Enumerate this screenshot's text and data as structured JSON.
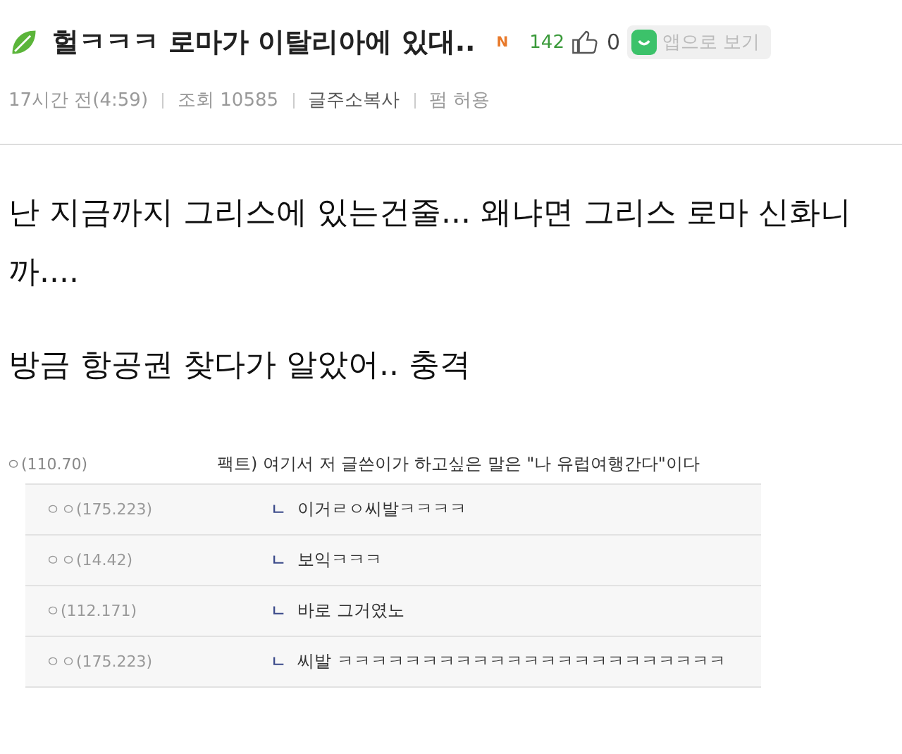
{
  "post": {
    "title": "헐ㅋㅋㅋ 로마가 이탈리아에 있대..",
    "badge": "N",
    "recommend_count": "142",
    "like_count": "0",
    "app_button": "앱으로 보기",
    "meta": [
      "17시간 전(4:59)",
      "조회 10585",
      "글주소복사",
      "펌 허용"
    ]
  },
  "body": [
    "난 지금까지 그리스에 있는건줄... 왜냐면 그리스 로마 신화니까....",
    "방금 항공권 찾다가 알았어.. 충격"
  ],
  "comments": [
    {
      "author": "ㅇ(110.70)",
      "text": "팩트) 여기서 저 글쓴이가 하고싶은 말은 \"나 유럽여행간다\"이다",
      "children": [
        {
          "marker": "ㄴ",
          "author": "ㅇㅇ(175.223)",
          "text": "이거ㄹㅇ씨발ㅋㅋㅋㅋ"
        },
        {
          "marker": "ㄴ",
          "author": "ㅇㅇ(14.42)",
          "text": "보익ㅋㅋㅋ"
        },
        {
          "marker": "ㄴ",
          "author": "ㅇ(112.171)",
          "text": "바로 그거였노"
        },
        {
          "marker": "ㄴ",
          "author": "ㅇㅇ(175.223)",
          "text": "씨발 ㅋㅋㅋㅋㅋㅋㅋㅋㅋㅋㅋㅋㅋㅋㅋㅋㅋㅋㅋㅋㅋㅋㅋ"
        }
      ]
    }
  ]
}
